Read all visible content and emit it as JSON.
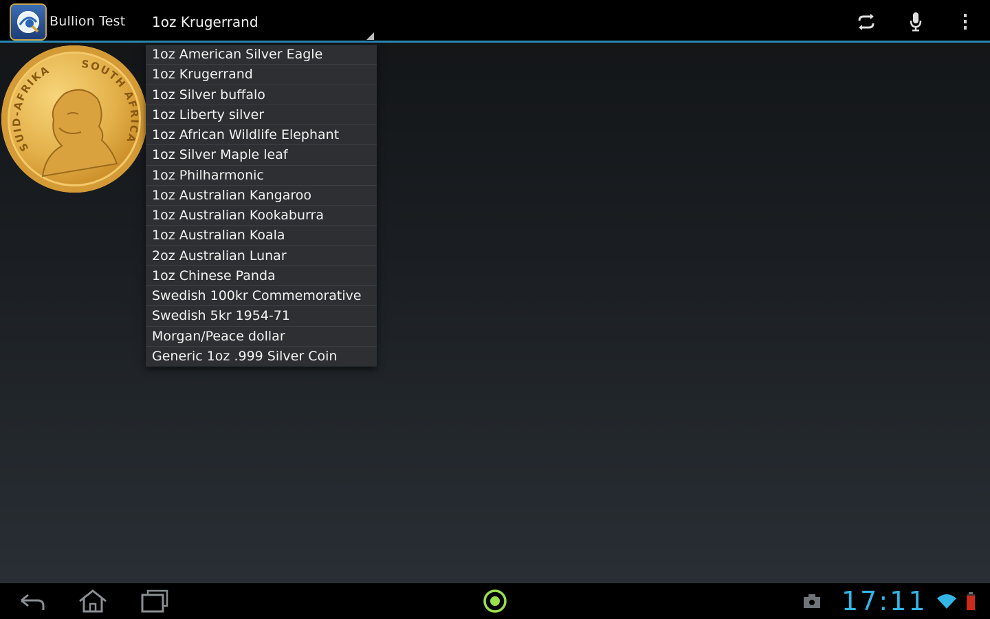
{
  "app": {
    "title": "Bullion Test"
  },
  "spinner": {
    "selected": "1oz Krugerrand"
  },
  "dropdown": {
    "items": [
      "1oz American Silver Eagle",
      "1oz Krugerrand",
      "1oz Silver buffalo",
      "1oz Liberty silver",
      "1oz African Wildlife Elephant",
      "1oz Silver Maple leaf",
      "1oz Philharmonic",
      "1oz Australian Kangaroo",
      "1oz Australian Kookaburra",
      "1oz Australian Koala",
      "2oz Australian Lunar",
      "1oz Chinese Panda",
      "Swedish 100kr Commemorative",
      "Swedish 5kr 1954-71",
      "Morgan/Peace dollar",
      "Generic 1oz .999 Silver Coin"
    ]
  },
  "coin": {
    "inscription_left": "SUID-AFRIKA",
    "inscription_right": "SOUTH AFRICA"
  },
  "action_icons": [
    "refresh-icon",
    "microphone-icon",
    "overflow-menu-icon"
  ],
  "nav": {
    "icons": [
      "back-icon",
      "home-icon",
      "recent-apps-icon",
      "app-center-icon",
      "screenshot-icon",
      "wifi-icon",
      "battery-icon"
    ]
  },
  "status": {
    "time": "17:11"
  },
  "colors": {
    "accent": "#33b5e5",
    "action_bar_divider": "#2b88b0",
    "dropdown_bg": "#2d2f32",
    "coin_gold": "#e3b04a",
    "nav_center_green": "#9ae04a"
  }
}
